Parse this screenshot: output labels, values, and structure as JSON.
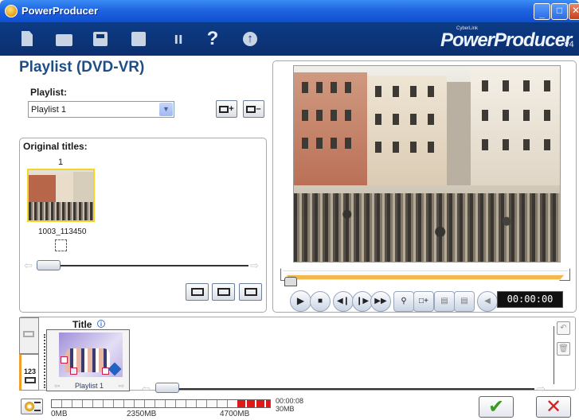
{
  "window": {
    "title": "PowerProducer"
  },
  "toolbar": {
    "icons": [
      "new-project-icon",
      "open-folder-icon",
      "save-icon",
      "export-icon",
      "tools-icon",
      "help-icon",
      "upgrade-icon"
    ],
    "help_glyph": "?",
    "brand": {
      "maker": "CyberLink",
      "name": "PowerProducer",
      "version": "v4"
    }
  },
  "left": {
    "page_title": "Playlist (DVD-VR)",
    "playlist_label": "Playlist:",
    "playlist_selected": "Playlist 1",
    "original_titles_label": "Original titles:",
    "clip": {
      "index": "1",
      "name": "1003_113450"
    }
  },
  "player": {
    "timecode": "00:00:00"
  },
  "storyboard": {
    "title_label": "Title",
    "tab_number": "123",
    "title_card_caption": "Playlist 1"
  },
  "footer": {
    "capacity_ticks": [
      "0MB",
      "2350MB",
      "4700MB"
    ],
    "duration": "00:00:08",
    "size": "30MB",
    "ok_glyph": "✔",
    "cancel_glyph": "✕"
  }
}
